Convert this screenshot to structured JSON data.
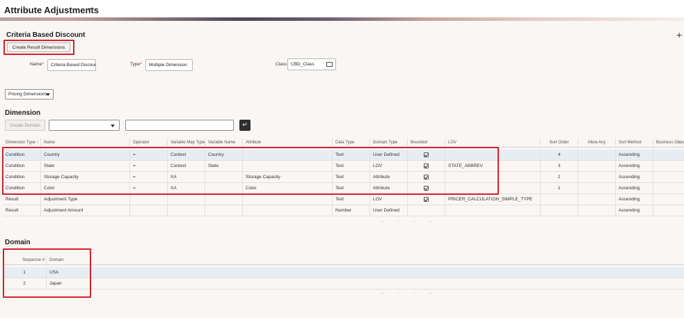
{
  "app_title": "Attribute Adjustments",
  "section_title": "Criteria Based Discount",
  "create_result_dimensions_label": "Create Result Dimensions",
  "form": {
    "name_label": "Name",
    "name_value": "Criteria Based Discoun",
    "type_label": "Type",
    "type_value": "Multiple Dimension",
    "class_label": "Class",
    "class_value": "CBD_Class"
  },
  "pricing_dimensions_label": "Pricing Dimensions",
  "dimension": {
    "title": "Dimension",
    "create_domain_label": "Create Domain",
    "columns": [
      "Dimension Type",
      "Name",
      "Operator",
      "Variable Map Type",
      "Variable Name",
      "Attribute",
      "Data Type",
      "Domain Type",
      "Bounded",
      "LOV",
      "Sort Order",
      "Allow Any",
      "Sort Method",
      "Business Object"
    ],
    "rows": [
      {
        "type": "Condition",
        "name": "Country",
        "operator": "=",
        "map_type": "Context",
        "var_name": "Country",
        "attribute": "",
        "data_type": "Text",
        "domain_type": "User Defined",
        "bounded": true,
        "lov": "",
        "sort_order": "4",
        "allow_any": "",
        "sort_method": "Ascending",
        "bo": ""
      },
      {
        "type": "Condition",
        "name": "State",
        "operator": "=",
        "map_type": "Context",
        "var_name": "State",
        "attribute": "",
        "data_type": "Text",
        "domain_type": "LOV",
        "bounded": true,
        "lov": "STATE_ABBREV",
        "sort_order": "3",
        "allow_any": "",
        "sort_method": "Ascending",
        "bo": ""
      },
      {
        "type": "Condition",
        "name": "Storage Capacity",
        "operator": "=",
        "map_type": "XA",
        "var_name": "",
        "attribute": "Storage Capacity",
        "data_type": "Text",
        "domain_type": "Attribute",
        "bounded": true,
        "lov": "",
        "sort_order": "2",
        "allow_any": "",
        "sort_method": "Ascending",
        "bo": ""
      },
      {
        "type": "Condition",
        "name": "Color",
        "operator": "=",
        "map_type": "XA",
        "var_name": "",
        "attribute": "Color",
        "data_type": "Text",
        "domain_type": "Attribute",
        "bounded": true,
        "lov": "",
        "sort_order": "1",
        "allow_any": "",
        "sort_method": "Ascending",
        "bo": ""
      },
      {
        "type": "Result",
        "name": "Adjustment Type",
        "operator": "",
        "map_type": "",
        "var_name": "",
        "attribute": "",
        "data_type": "Text",
        "domain_type": "LOV",
        "bounded": true,
        "lov": "PRICER_CALCULATION_SIMPLE_TYPE",
        "sort_order": "",
        "allow_any": "",
        "sort_method": "Ascending",
        "bo": ""
      },
      {
        "type": "Result",
        "name": "Adjustment Amount",
        "operator": "",
        "map_type": "",
        "var_name": "",
        "attribute": "",
        "data_type": "Number",
        "domain_type": "User Defined",
        "bounded": false,
        "lov": "",
        "sort_order": "",
        "allow_any": "",
        "sort_method": "Ascending",
        "bo": ""
      }
    ],
    "pager": [
      "«",
      "‹",
      "›",
      "»"
    ]
  },
  "domain": {
    "title": "Domain",
    "columns": [
      "Sequence #",
      "Domain"
    ],
    "rows": [
      {
        "seq": "1",
        "domain": "USA"
      },
      {
        "seq": "2",
        "domain": "Japan"
      }
    ],
    "pager": [
      "«",
      "‹",
      "›",
      "»"
    ]
  },
  "icons": {
    "title_dropdown": "chevron-down-icon",
    "add": "plus-icon",
    "sort": "sort-arrow-icon",
    "class_lookup": "lookup-icon",
    "go": "enter-arrow-icon",
    "bounded": "checkbox-checked-icon"
  },
  "colors": {
    "highlight": "#d4202a",
    "selected_row": "#e7eef3"
  }
}
